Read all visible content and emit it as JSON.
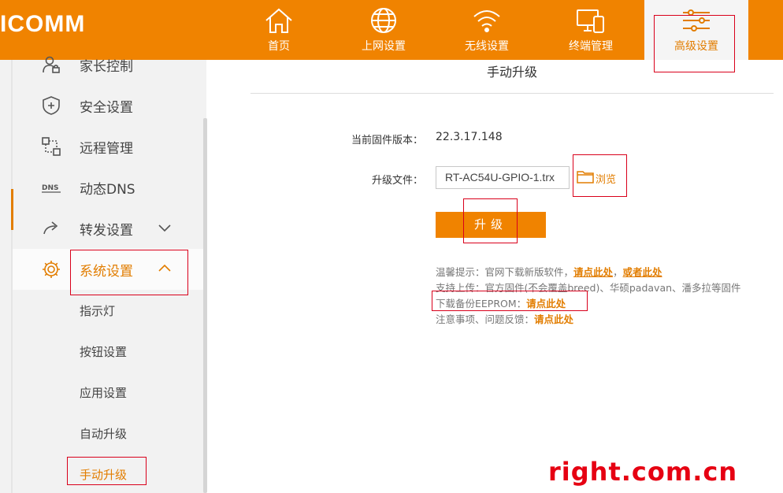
{
  "brand": {
    "logo_text": "ICOMM"
  },
  "nav": {
    "items": [
      {
        "label": "首页",
        "icon": "home-icon"
      },
      {
        "label": "上网设置",
        "icon": "globe-icon"
      },
      {
        "label": "无线设置",
        "icon": "wifi-icon"
      },
      {
        "label": "终端管理",
        "icon": "devices-icon"
      },
      {
        "label": "高级设置",
        "icon": "sliders-icon",
        "active": true
      }
    ]
  },
  "sidebar": {
    "items": [
      {
        "label": "家长控制",
        "icon": "parental-icon"
      },
      {
        "label": "安全设置",
        "icon": "shield-icon"
      },
      {
        "label": "远程管理",
        "icon": "remote-icon"
      },
      {
        "label": "动态DNS",
        "icon": "dns-icon"
      },
      {
        "label": "转发设置",
        "icon": "forward-icon",
        "expand": "collapsed"
      },
      {
        "label": "系统设置",
        "icon": "gear-icon",
        "expand": "expanded",
        "active": true
      }
    ],
    "subitems": [
      {
        "label": "指示灯"
      },
      {
        "label": "按钮设置"
      },
      {
        "label": "应用设置"
      },
      {
        "label": "自动升级"
      },
      {
        "label": "手动升级",
        "active": true
      }
    ]
  },
  "main": {
    "title": "手动升级",
    "firmware_label": "当前固件版本：",
    "firmware_version": "22.3.17.148",
    "file_label": "升级文件：",
    "file_value": "RT-AC54U-GPIO-1.trx",
    "browse_label": "浏览",
    "upgrade_label": "升级",
    "tips": {
      "line1_prefix": "温馨提示：官网下载新版软件，",
      "line1_link1": "请点此处",
      "line1_sep": "，",
      "line1_link2": "或者此处",
      "line2": "支持上传：官方固件(不会覆盖breed)、华硕padavan、潘多拉等固件",
      "line3_prefix": "下载备份EEPROM：",
      "line3_link": "请点此处",
      "line4_prefix": "注意事项、问题反馈：",
      "line4_link": "请点此处"
    }
  },
  "watermark": "right.com.cn",
  "colors": {
    "accent": "#f08300",
    "accent_text": "#e27d00",
    "annotation": "#d9001b",
    "watermark": "#e60012"
  }
}
